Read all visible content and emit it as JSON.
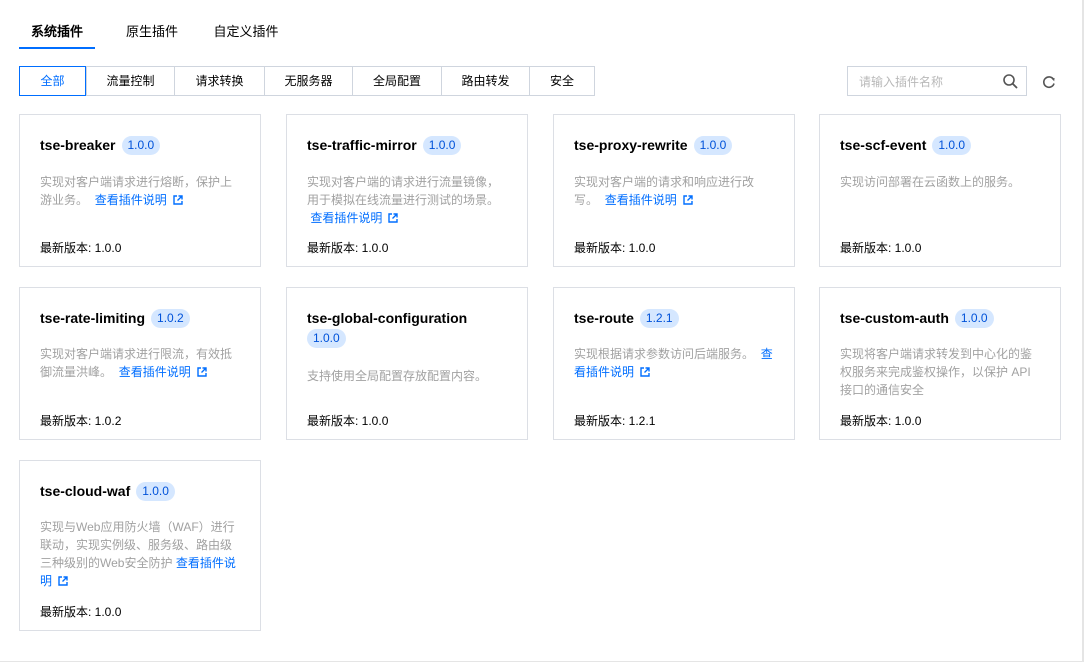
{
  "tabs": [
    {
      "label": "系统插件",
      "active": true
    },
    {
      "label": "原生插件",
      "active": false
    },
    {
      "label": "自定义插件",
      "active": false
    }
  ],
  "filters": [
    {
      "label": "全部",
      "active": true
    },
    {
      "label": "流量控制"
    },
    {
      "label": "请求转换"
    },
    {
      "label": "无服务器"
    },
    {
      "label": "全局配置"
    },
    {
      "label": "路由转发"
    },
    {
      "label": "安全"
    }
  ],
  "search": {
    "placeholder": "请输入插件名称",
    "value": "",
    "icon": "search-icon"
  },
  "refresh": {
    "icon": "refresh-icon"
  },
  "colors": {
    "accent": "#006eff",
    "badge_bg": "#d5e7ff",
    "badge_text": "#0052d9",
    "desc": "#a1a1a1",
    "border": "#dcdfe5"
  },
  "latest_label": "最新版本: ",
  "plugins": [
    {
      "name": "tse-breaker",
      "version": "1.0.0",
      "desc": "实现对客户端请求进行熔断，保护上游业务。",
      "link": "查看插件说明",
      "latest": "1.0.0"
    },
    {
      "name": "tse-traffic-mirror",
      "version": "1.0.0",
      "desc": "实现对客户端的请求进行流量镜像，用于模拟在线流量进行测试的场景。",
      "link": "查看插件说明",
      "latest": "1.0.0"
    },
    {
      "name": "tse-proxy-rewrite",
      "version": "1.0.0",
      "desc": "实现对客户端的请求和响应进行改写。",
      "link": "查看插件说明",
      "latest": "1.0.0"
    },
    {
      "name": "tse-scf-event",
      "version": "1.0.0",
      "desc": "实现访问部署在云函数上的服务。",
      "link": "",
      "latest": "1.0.0"
    },
    {
      "name": "tse-rate-limiting",
      "version": "1.0.2",
      "desc": "实现对客户端请求进行限流，有效抵御流量洪峰。",
      "link": "查看插件说明",
      "latest": "1.0.2"
    },
    {
      "name": "tse-global-configuration",
      "version": "1.0.0",
      "desc": "支持使用全局配置存放配置内容。",
      "link": "",
      "latest": "1.0.0"
    },
    {
      "name": "tse-route",
      "version": "1.2.1",
      "desc": "实现根据请求参数访问后端服务。",
      "link": "查看插件说明",
      "latest": "1.2.1"
    },
    {
      "name": "tse-custom-auth",
      "version": "1.0.0",
      "desc": "实现将客户端请求转发到中心化的鉴权服务来完成鉴权操作，以保护 API 接口的通信安全",
      "link": "",
      "latest": "1.0.0"
    },
    {
      "name": "tse-cloud-waf",
      "version": "1.0.0",
      "desc": "实现与Web应用防火墙（WAF）进行联动，实现实例级、服务级、路由级三种级别的Web安全防护",
      "link": "查看插件说明",
      "latest": "1.0.0"
    }
  ]
}
